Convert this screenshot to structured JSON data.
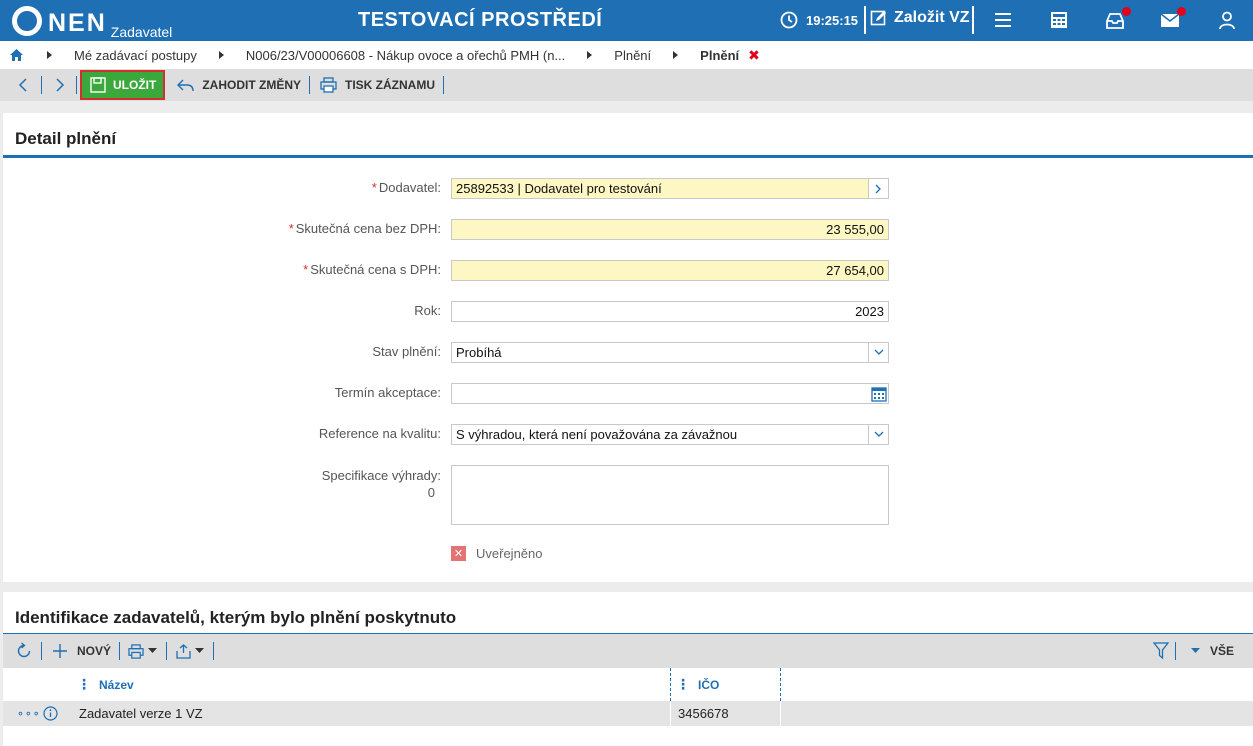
{
  "header": {
    "logo_text": "NEN",
    "logo_sub": "Zadavatel",
    "environment_title": "TESTOVACÍ PROSTŘEDÍ",
    "time": "19:25:15",
    "create_label": "Založit VZ",
    "icons": [
      "clock-icon",
      "edit-icon",
      "menu-icon",
      "calculator-icon",
      "inbox-icon",
      "mail-icon",
      "user-icon"
    ],
    "accent_color": "#1e6fb3",
    "notification_color": "#e3001b"
  },
  "breadcrumb": {
    "items": [
      "Mé zadávací postupy",
      "N006/23/V00006608 - Nákup ovoce a ořechů PMH (n...",
      "Plnění"
    ],
    "current": "Plnění"
  },
  "toolbar": {
    "save_label": "ULOŽIT",
    "discard_label": "ZAHODIT ZMĚNY",
    "print_label": "TISK ZÁZNAMU",
    "save_color": "#3aa83a"
  },
  "detail": {
    "title": "Detail plnění",
    "fields": {
      "dodavatel": {
        "label": "Dodavatel:",
        "value": "25892533 | Dodavatel pro testování",
        "required": true
      },
      "cena_bez_dph": {
        "label": "Skutečná cena bez DPH:",
        "value": "23 555,00",
        "required": true
      },
      "cena_s_dph": {
        "label": "Skutečná cena s DPH:",
        "value": "27 654,00",
        "required": true
      },
      "rok": {
        "label": "Rok:",
        "value": "2023"
      },
      "stav": {
        "label": "Stav plnění:",
        "value": "Probíhá"
      },
      "termin": {
        "label": "Termín akceptace:",
        "value": ""
      },
      "reference": {
        "label": "Reference na kvalitu:",
        "value": "S výhradou, která není považována za závažnou"
      },
      "specifikace": {
        "label": "Specifikace výhrady:",
        "counter": "0",
        "value": ""
      }
    },
    "published_label": "Uveřejněno",
    "required_color": "#fdf7c3"
  },
  "zadavatele": {
    "title": "Identifikace zadavatelů, kterým bylo plnění poskytnuto",
    "new_label": "NOVÝ",
    "filter_label": "VŠE",
    "columns": [
      "Název",
      "IČO"
    ],
    "rows": [
      {
        "nazev": "Zadavatel verze 1 VZ",
        "ico": "3456678"
      }
    ]
  }
}
